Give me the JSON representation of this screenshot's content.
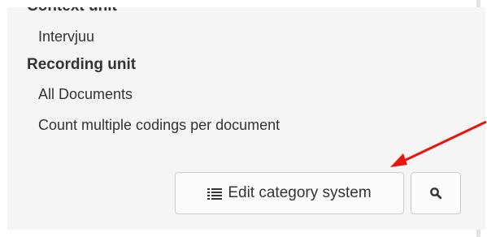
{
  "context_unit": {
    "heading": "Context unit",
    "value": "Intervjuu"
  },
  "recording_unit": {
    "heading": "Recording unit",
    "values": [
      "All Documents",
      "Count multiple codings per document"
    ]
  },
  "buttons": {
    "edit_category_system": "Edit category system",
    "edit_icon": "list-icon",
    "search_icon": "search-icon"
  },
  "annotation": {
    "arrow_color": "#e8140f"
  }
}
